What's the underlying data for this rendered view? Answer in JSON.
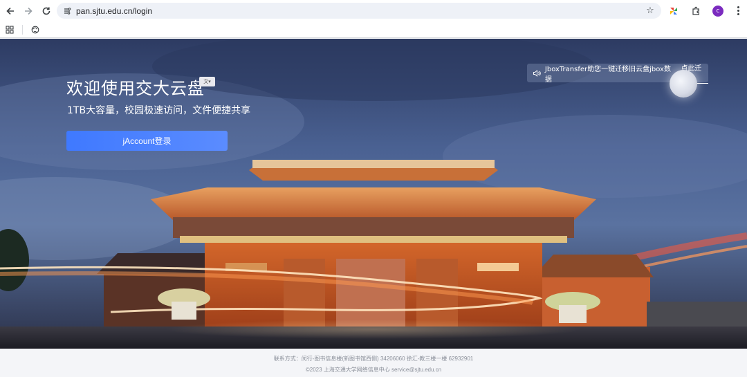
{
  "browser": {
    "url": "pan.sjtu.edu.cn/login",
    "profile_initial": "c"
  },
  "hero": {
    "title": "欢迎使用交大云盘",
    "subtitle": "1TB大容量，校园极速访问，文件便捷共享",
    "login_button": "jAccount登录",
    "notice_text": "JboxTransfer助您一键迁移旧云盘jbox数据",
    "notice_link": "点此迁移"
  },
  "footer": {
    "contact": "联系方式：闵行-图书信息楼(新图书馆西侧) 34206060 徐汇-教三楼一楼 62932901",
    "copyright": "©2023 上海交通大学网络信息中心 service@sjtu.edu.cn"
  },
  "colors": {
    "accent": "#4a82ff",
    "profile": "#7b2bbf"
  }
}
